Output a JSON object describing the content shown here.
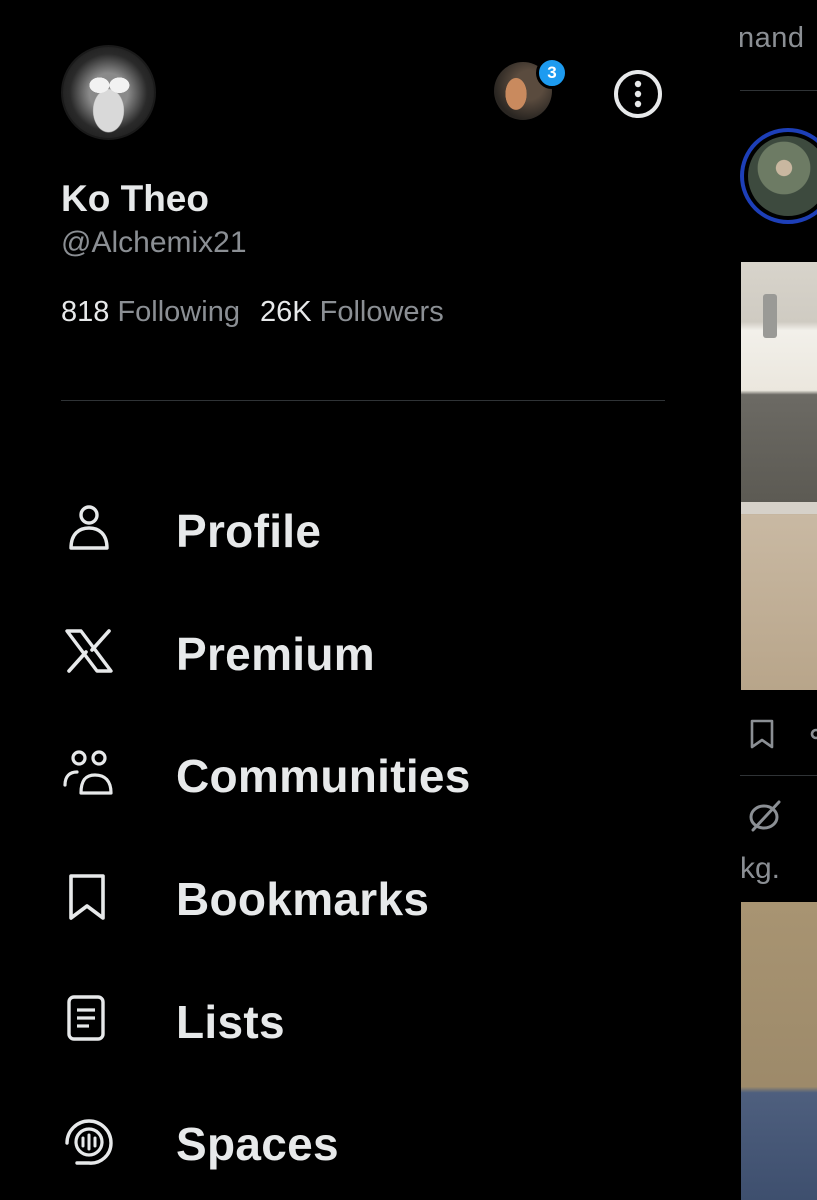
{
  "timeline": {
    "tab_partial_text": "nand",
    "truncated_text": "kg."
  },
  "account": {
    "display_name": "Ko Theo",
    "handle": "@Alchemix21",
    "following_count": "818",
    "following_label": "Following",
    "followers_count": "26K",
    "followers_label": "Followers",
    "switch_badge_count": "3"
  },
  "menu": {
    "items": [
      {
        "label": "Profile",
        "icon": "person-icon"
      },
      {
        "label": "Premium",
        "icon": "x-logo-icon"
      },
      {
        "label": "Communities",
        "icon": "communities-icon"
      },
      {
        "label": "Bookmarks",
        "icon": "bookmark-icon"
      },
      {
        "label": "Lists",
        "icon": "list-icon"
      },
      {
        "label": "Spaces",
        "icon": "spaces-icon"
      }
    ]
  },
  "colors": {
    "background": "#000000",
    "primary_text": "#e7e9ea",
    "secondary_text": "#8b8f94",
    "divider": "#2f3336",
    "badge": "#1d9bf0"
  }
}
